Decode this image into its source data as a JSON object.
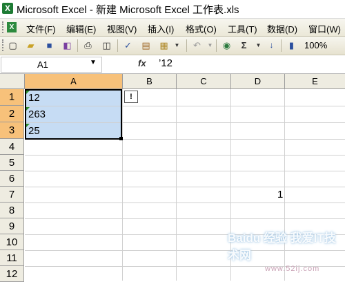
{
  "window": {
    "title": "Microsoft Excel - 新建 Microsoft Excel 工作表.xls"
  },
  "menu": {
    "items": [
      {
        "label": "文件(F)"
      },
      {
        "label": "编辑(E)"
      },
      {
        "label": "视图(V)"
      },
      {
        "label": "插入(I)"
      },
      {
        "label": "格式(O)"
      },
      {
        "label": "工具(T)"
      },
      {
        "label": "数据(D)"
      },
      {
        "label": "窗口(W)"
      }
    ]
  },
  "toolbar": {
    "zoom": "100%",
    "sum_label": "Σ"
  },
  "formula_bar": {
    "name_box": "A1",
    "fx_label": "fx",
    "formula": "’12"
  },
  "sheet": {
    "columns": [
      "A",
      "B",
      "C",
      "D",
      "E"
    ],
    "selected_column": "A",
    "rows": [
      "1",
      "2",
      "3",
      "4",
      "5",
      "6",
      "7",
      "8",
      "9",
      "10",
      "11",
      "12"
    ],
    "selected_rows": [
      "1",
      "2",
      "3"
    ],
    "cells": {
      "A1": "12",
      "A2": "263",
      "A3": "25",
      "D7": "1"
    },
    "smart_tag": "!"
  },
  "watermark": {
    "text": "Baidu 经验 我爱IT技术网",
    "url": "www.52ij.com"
  }
}
